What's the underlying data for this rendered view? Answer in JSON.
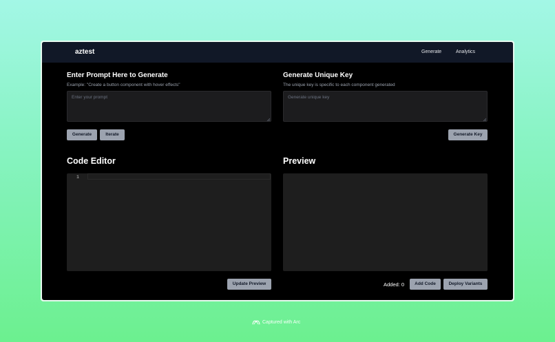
{
  "app": {
    "brand": "aztest",
    "nav": [
      "Generate",
      "Analytics"
    ]
  },
  "prompt_section": {
    "title": "Enter Prompt Here to Generate",
    "hint": "Example: \"Create a button component with hover effects\"",
    "placeholder": "Enter your prompt",
    "value": "",
    "generate_label": "Generate",
    "iterate_label": "Iterate"
  },
  "key_section": {
    "title": "Generate Unique Key",
    "hint": "The unique key is specific to each component generated",
    "placeholder": "Generate unique key",
    "value": "",
    "button_label": "Generate Key"
  },
  "editor": {
    "title": "Code Editor",
    "line_numbers": [
      "1"
    ],
    "update_label": "Update Preview"
  },
  "preview": {
    "title": "Preview",
    "added_text": "Added: 0",
    "add_code_label": "Add Code",
    "deploy_label": "Deploy Variants"
  },
  "watermark": {
    "text": "Captured with Arc"
  },
  "colors": {
    "navbar": "#111827",
    "app_background": "#000000",
    "button": "#9ca3af",
    "panel": "#1e1e1e"
  },
  "icons": {
    "watermark": "arc-logo-icon"
  }
}
